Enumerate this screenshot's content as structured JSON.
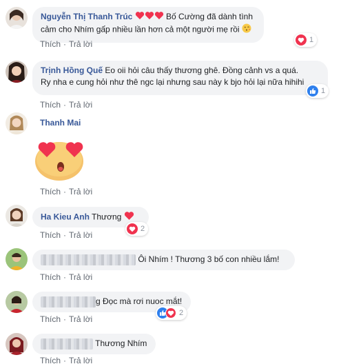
{
  "actions": {
    "like_label": "Thích",
    "reply_label": "Trả lời",
    "separator": "·"
  },
  "comments": [
    {
      "author": "Nguyễn Thị Thanh Trúc",
      "text": "Bố Cường đã dành tình cảm cho Nhím gấp nhiều lần hơn cả một người mẹ rồi",
      "reaction_count": "1"
    },
    {
      "author": "Trịnh Hồng Quế",
      "text_line1": "Eo oii hỏi câu thấy thương ghê. Đồng cảnh vs a quá.",
      "text_line2": "Ry nha e cung hỏi như thê ngc lại nhưng sau này k bjo hỏi lại nữa hihihi",
      "reaction_count": "1"
    },
    {
      "author": "Thanh Mai",
      "sticker": "heart-eyes-emoji"
    },
    {
      "author": "Ha Kieu Anh",
      "text": "Thương",
      "reaction_count": "2"
    },
    {
      "author": "",
      "text": "Ôi Nhím ! Thương 3 bố con nhiều lắm!"
    },
    {
      "author": "",
      "text": "g Đọc mà rơi nuoc mắt!",
      "reaction_count": "2"
    },
    {
      "author": "",
      "text": "Thương Nhím"
    }
  ],
  "colors": {
    "author": "#385898",
    "bubble": "#f2f3f5",
    "love": "#f0334f",
    "like": "#2f80ed",
    "meta": "#606770"
  }
}
